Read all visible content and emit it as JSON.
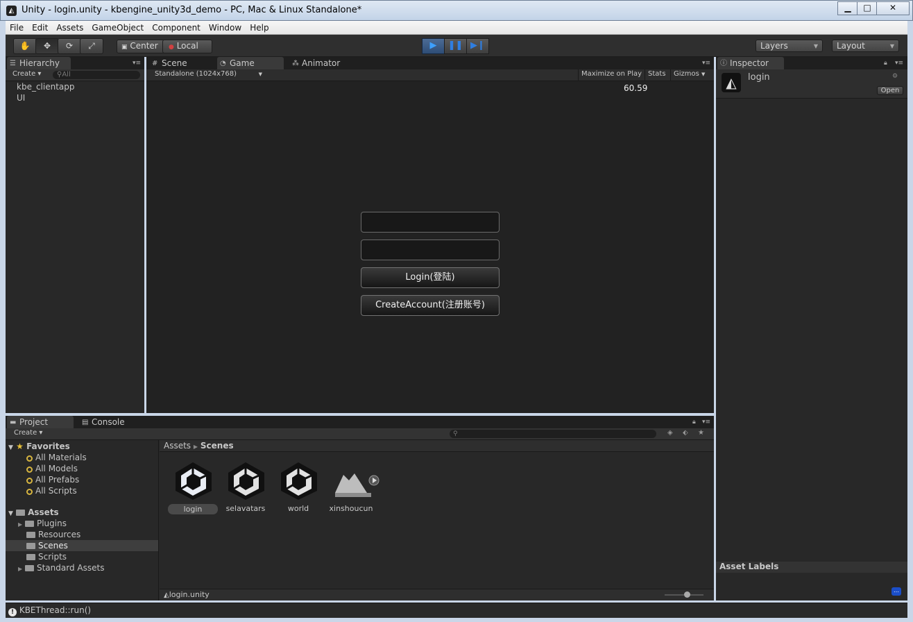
{
  "window": {
    "title": "Unity - login.unity - kbengine_unity3d_demo - PC, Mac & Linux Standalone*"
  },
  "menu": [
    "File",
    "Edit",
    "Assets",
    "GameObject",
    "Component",
    "Window",
    "Help"
  ],
  "toolbar": {
    "transform_tools": [
      "hand-icon",
      "move-icon",
      "rotate-icon",
      "scale-icon"
    ],
    "pivot_label": "Center",
    "space_label": "Local",
    "layers_label": "Layers",
    "layout_label": "Layout"
  },
  "hierarchy": {
    "tab": "Hierarchy",
    "create": "Create",
    "search_placeholder": "All",
    "items": [
      "kbe_clientapp",
      "UI"
    ]
  },
  "center_tabs": [
    "Scene",
    "Game",
    "Animator"
  ],
  "game": {
    "resolution": "Standalone (1024x768)",
    "maximize": "Maximize on Play",
    "stats": "Stats",
    "gizmos": "Gizmos",
    "fps": "60.59",
    "login_button": "Login(登陆)",
    "create_account_button": "CreateAccount(注册账号)"
  },
  "inspector": {
    "tab": "Inspector",
    "object": "login",
    "open": "Open",
    "asset_labels": "Asset Labels"
  },
  "bottom_tabs": [
    "Project",
    "Console"
  ],
  "project": {
    "create": "Create",
    "favorites_label": "Favorites",
    "favorites": [
      "All Materials",
      "All Models",
      "All Prefabs",
      "All Scripts"
    ],
    "assets_label": "Assets",
    "folders": [
      "Plugins",
      "Resources",
      "Scenes",
      "Scripts",
      "Standard Assets"
    ],
    "breadcrumb": [
      "Assets",
      "Scenes"
    ],
    "assets": [
      "login",
      "selavatars",
      "world",
      "xinshoucun"
    ],
    "footer_path": "login.unity"
  },
  "status": {
    "text": "KBEThread::run()"
  },
  "colors": {
    "panel": "#282828",
    "play_active": "#3da0ff",
    "accent": "#2e4d76"
  }
}
